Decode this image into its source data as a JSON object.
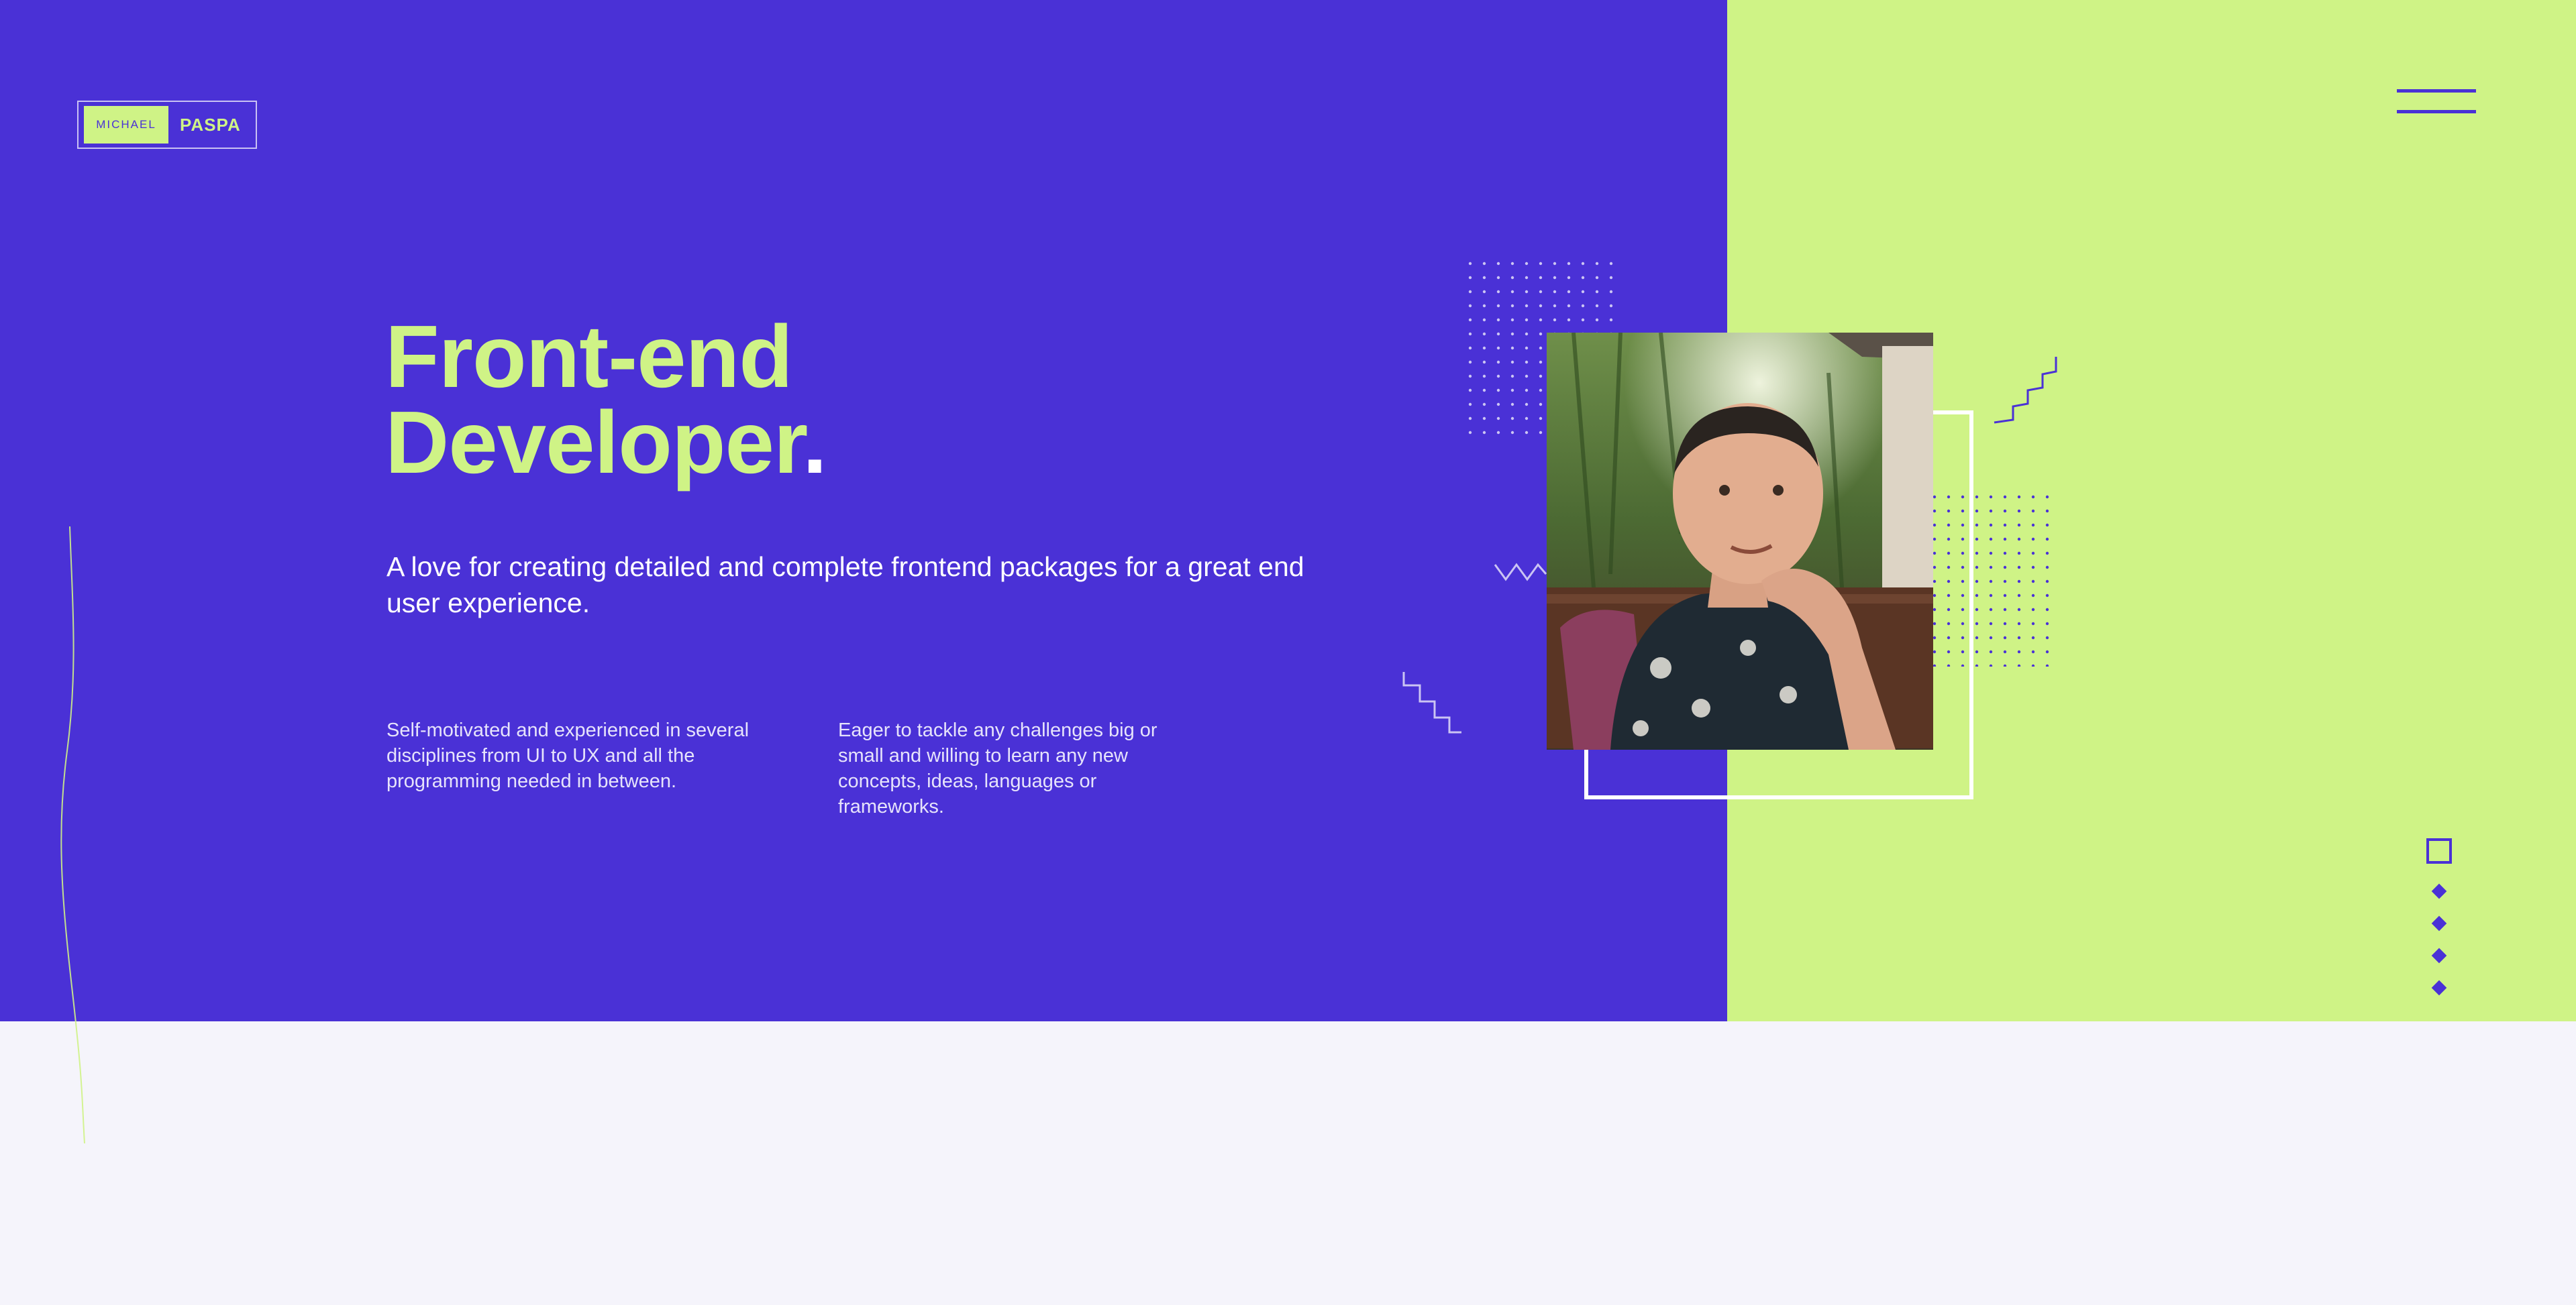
{
  "logo": {
    "first": "MICHAEL",
    "last": "PASPA"
  },
  "menu": {
    "icon": "hamburger-icon"
  },
  "hero": {
    "title_line1": "Front-end",
    "title_line2": "Developer",
    "title_dot": ".",
    "lead": "A love for creating detailed and complete frontend packages for a great end user experience.",
    "detail_1": "Self-motivated and experienced in several disciplines from UI to UX and all the programming needed in between.",
    "detail_2": "Eager to tackle any challenges big or small and willing to learn any new concepts, ideas, languages or frameworks."
  },
  "colors": {
    "primary": "#4a31d6",
    "accent": "#cff386",
    "background": "#f5f4fb",
    "white": "#ffffff"
  },
  "slider": {
    "indicator_icon": "square-outline-icon",
    "dot_icon": "diamond-icon",
    "dot_count": 4
  },
  "photo": {
    "subject": "portrait"
  }
}
